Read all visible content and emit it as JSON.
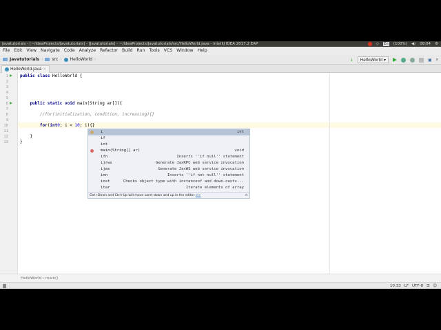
{
  "window": {
    "title": "Javatutorials - [~/IdeaProjects/Javatutorials] - [Javatutorials] - ~/IdeaProjects/Javatutorials/src/HelloWorld.java - IntelliJ IDEA 2017.2 EAP"
  },
  "tray": {
    "lang": "En",
    "battery": "(100%)",
    "time": "08:04"
  },
  "menu": [
    "File",
    "Edit",
    "View",
    "Navigate",
    "Code",
    "Analyze",
    "Refactor",
    "Build",
    "Run",
    "Tools",
    "VCS",
    "Window",
    "Help"
  ],
  "nav": {
    "project": "Javatutorials",
    "folder": "src",
    "file": "HelloWorld",
    "run_config": "HelloWorld"
  },
  "tab": {
    "label": "HelloWorld.java"
  },
  "code": {
    "lines": [
      "1",
      "2",
      "3",
      "4",
      "5",
      "6",
      "7",
      "8",
      "9",
      "10",
      "11",
      "12",
      "13"
    ],
    "l1a": "public class ",
    "l1b": "HelloWorld {",
    "l6a": "    public static void ",
    "l6b": "main(String ar[]){",
    "l8": "        //for(initialization, condition, increasing){}",
    "l10a": "        for",
    "l10b": "(",
    "l10c": "int",
    " l10d": " i = ",
    "l10e": "0",
    "l10f": "; i < ",
    "l10g": "10",
    "l10h": "; i){}",
    "l12": "    }",
    "l13": "}"
  },
  "completion": {
    "items": [
      {
        "name": "i",
        "tail": "int"
      },
      {
        "name": "if",
        "tail": ""
      },
      {
        "name": "int",
        "tail": ""
      },
      {
        "name": "main(String[] ar)",
        "tail": "void"
      },
      {
        "name": "ifn",
        "tail": "Inserts ''if null'' statement"
      },
      {
        "name": "ijrws",
        "tail": "Generate JaxRPC web service invocation"
      },
      {
        "name": "ijws",
        "tail": "Generate JaxWS web service invocation"
      },
      {
        "name": "inn",
        "tail": "Inserts ''if not null'' statement"
      },
      {
        "name": "inst",
        "tail": "Checks object type with instanceof and down-casts..."
      },
      {
        "name": "itar",
        "tail": "Iterate elements of array"
      }
    ],
    "hint": "Ctrl+Down and Ctrl+Up will move caret down and up in the editor",
    "hint_link": ">>",
    "pi": "π"
  },
  "footer": {
    "breadcrumb": "HelloWorld",
    "method": "main()"
  },
  "status": {
    "position": "10:33",
    "line_sep": "LF",
    "encoding": "UTF-8"
  }
}
